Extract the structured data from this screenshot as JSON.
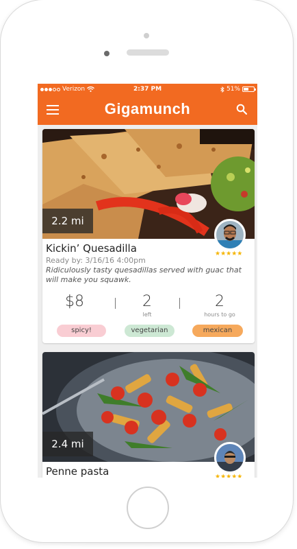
{
  "status_bar": {
    "carrier": "Verizon",
    "time": "2:37 PM",
    "battery_text": "51%",
    "battery_level": 0.51
  },
  "app_bar": {
    "title": "Gigamunch",
    "menu_icon": "hamburger-menu-icon",
    "search_icon": "search-icon"
  },
  "colors": {
    "brand": "#f26a21",
    "star": "#f5b400",
    "tag_spicy": "#f9cdd3",
    "tag_vegetarian": "#cde8d4",
    "tag_mexican": "#f6a95c"
  },
  "meals": [
    {
      "distance": "2.2 mi",
      "name": "Kickin’ Quesadilla",
      "ready": "Ready by: 3/16/16 4:00pm",
      "description": "Ridiculously tasty quesadillas served with guac that will make you squawk.",
      "rating": 5,
      "stars": "★★★★★",
      "price": "$8",
      "left": "2",
      "left_label": "left",
      "hours": "2",
      "hours_label": "hours to go",
      "tags": [
        "spicy!",
        "vegetarian",
        "mexican"
      ]
    },
    {
      "distance": "2.4 mi",
      "name": "Penne pasta",
      "rating": 5,
      "stars": "★★★★★"
    }
  ]
}
